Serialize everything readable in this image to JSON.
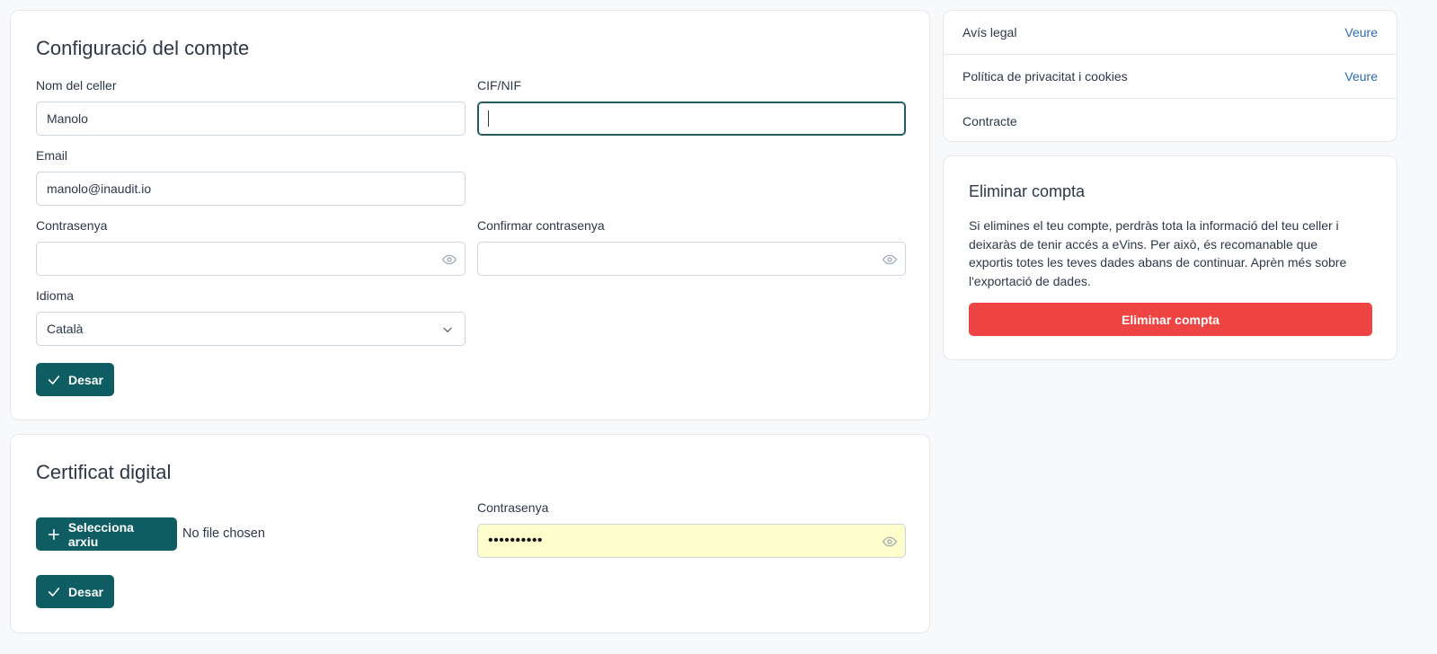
{
  "account": {
    "title": "Configuració del compte",
    "winery_name_label": "Nom del celler",
    "winery_name_value": "Manolo",
    "cif_label": "CIF/NIF",
    "cif_value": "",
    "email_label": "Email",
    "email_value": "manolo@inaudit.io",
    "password_label": "Contrasenya",
    "confirm_password_label": "Confirmar contrasenya",
    "language_label": "Idioma",
    "language_value": "Català",
    "save_label": "Desar"
  },
  "certificate": {
    "title": "Certificat digital",
    "select_file_label": "Selecciona arxiu",
    "no_file_text": "No file chosen",
    "password_label": "Contrasenya",
    "password_mask": "••••••••••",
    "save_label": "Desar"
  },
  "legal_links": [
    {
      "label": "Avís legal",
      "action": "Veure"
    },
    {
      "label": "Política de privacitat i cookies",
      "action": "Veure"
    },
    {
      "label": "Contracte",
      "action": ""
    }
  ],
  "delete_account": {
    "title": "Eliminar compta",
    "description": "Si elimines el teu compte, perdràs tota la informació del teu celler i deixaràs de tenir accés a eVins. Per això, és recomanable que exportis totes les teves dades abans de continuar. Aprèn més sobre l'exportació de dades.",
    "button_label": "Eliminar compta"
  },
  "colors": {
    "primary": "#0e5d63",
    "danger": "#ef4444",
    "link": "#2b6cb0",
    "autofill": "#fefdcc"
  },
  "icons": {
    "password_toggle": "eye-icon",
    "language_select": "chevron-down-icon",
    "save": "check-icon",
    "select_file": "plus-icon"
  }
}
